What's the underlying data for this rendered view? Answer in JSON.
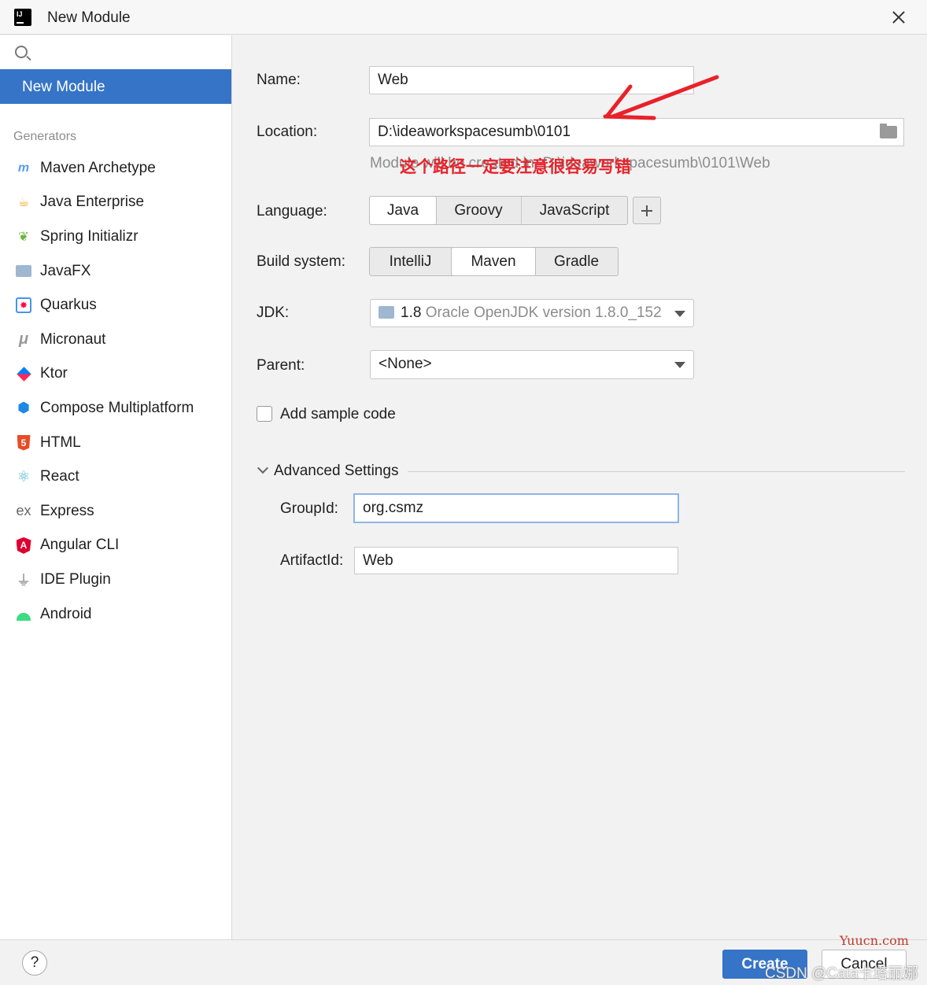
{
  "window": {
    "title": "New Module"
  },
  "sidebar": {
    "selected": "New Module",
    "section_label": "Generators",
    "items": [
      {
        "label": "Maven Archetype",
        "icon": "maven-icon"
      },
      {
        "label": "Java Enterprise",
        "icon": "java-enterprise-icon"
      },
      {
        "label": "Spring Initializr",
        "icon": "spring-icon"
      },
      {
        "label": "JavaFX",
        "icon": "javafx-folder-icon"
      },
      {
        "label": "Quarkus",
        "icon": "quarkus-icon"
      },
      {
        "label": "Micronaut",
        "icon": "micronaut-icon"
      },
      {
        "label": "Ktor",
        "icon": "ktor-icon"
      },
      {
        "label": "Compose Multiplatform",
        "icon": "compose-icon"
      },
      {
        "label": "HTML",
        "icon": "html5-icon"
      },
      {
        "label": "React",
        "icon": "react-icon"
      },
      {
        "label": "Express",
        "icon": "express-icon"
      },
      {
        "label": "Angular CLI",
        "icon": "angular-icon"
      },
      {
        "label": "IDE Plugin",
        "icon": "plugin-icon"
      },
      {
        "label": "Android",
        "icon": "android-icon"
      }
    ]
  },
  "form": {
    "name_label": "Name:",
    "name_value": "Web",
    "location_label": "Location:",
    "location_value": "D:\\ideaworkspacesumb\\0101",
    "location_hint": "Module will be created in: D:\\ideaworkspacesumb\\0101\\Web",
    "annotation": "这个路径一定要注意很容易写错",
    "language_label": "Language:",
    "languages": [
      "Java",
      "Groovy",
      "JavaScript"
    ],
    "language_selected": "Java",
    "build_label": "Build system:",
    "build_systems": [
      "IntelliJ",
      "Maven",
      "Gradle"
    ],
    "build_selected": "Maven",
    "jdk_label": "JDK:",
    "jdk_version": "1.8",
    "jdk_desc": "Oracle OpenJDK version 1.8.0_152",
    "parent_label": "Parent:",
    "parent_value": "<None>",
    "sample_code_label": "Add sample code",
    "sample_code_checked": false,
    "advanced_label": "Advanced Settings",
    "groupid_label": "GroupId:",
    "groupid_value": "org.csmz",
    "artifactid_label": "ArtifactId:",
    "artifactid_value": "Web"
  },
  "footer": {
    "help": "?",
    "create": "Create",
    "cancel": "Cancel"
  },
  "watermarks": {
    "site": "Yuucn.com",
    "author": "CSDN @Cata卡塔丽娜"
  },
  "colors": {
    "accent": "#3574c6",
    "annotation": "#e8222a"
  }
}
